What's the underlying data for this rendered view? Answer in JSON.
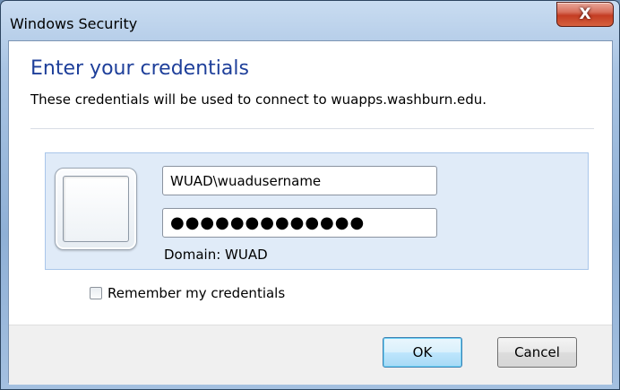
{
  "window": {
    "title": "Windows Security",
    "close_glyph": "X"
  },
  "dialog": {
    "heading": "Enter your credentials",
    "subtext": "These credentials will be used to connect to wuapps.washburn.edu."
  },
  "credentials": {
    "username": "WUAD\\wuadusername",
    "password_mask": "●●●●●●●●●●●●●",
    "domain_label": "Domain: WUAD"
  },
  "options": {
    "remember_label": "Remember my credentials",
    "remember_checked": false
  },
  "buttons": {
    "ok": "OK",
    "cancel": "Cancel"
  },
  "colors": {
    "heading": "#1e3f9a",
    "panel_bg": "#e0ebf8",
    "close_button": "#c43d23"
  }
}
